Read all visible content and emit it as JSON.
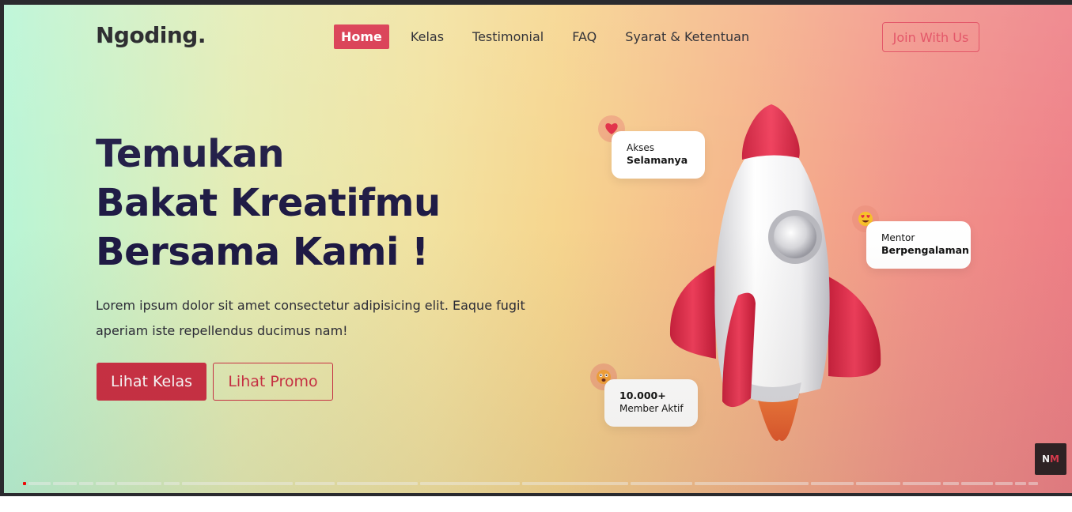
{
  "brand": {
    "logo_text": "Ngoding."
  },
  "nav": {
    "items": [
      {
        "label": "Home",
        "active": true
      },
      {
        "label": "Kelas",
        "active": false
      },
      {
        "label": "Testimonial",
        "active": false
      },
      {
        "label": "FAQ",
        "active": false
      },
      {
        "label": "Syarat & Ketentuan",
        "active": false
      }
    ],
    "cta_label": "Join With Us"
  },
  "hero": {
    "title_line1": "Temukan",
    "title_line2": "Bakat Kreatifmu",
    "title_line3": "Bersama Kami !",
    "description": "Lorem ipsum dolor sit amet consectetur adipisicing elit. Eaque fugit aperiam iste repellendus ducimus nam!",
    "primary_button": "Lihat Kelas",
    "secondary_button": "Lihat Promo"
  },
  "badges": [
    {
      "line1": "Akses",
      "line2": "Selamanya",
      "icon": "heart-icon"
    },
    {
      "line1": "Mentor",
      "line2": "Berpengalaman",
      "icon": "heart-eyes-emoji-icon"
    },
    {
      "line1": "10.000+",
      "line2": "Member Aktif",
      "icon": "dizzy-face-emoji-icon"
    }
  ],
  "watermark": {
    "text_a": "N",
    "text_b": "M"
  },
  "colors": {
    "accent": "#d8344b",
    "heading": "#1e1a44",
    "rocket_red": "#e0304c",
    "progress_played": "#ff0000"
  },
  "video_progress": {
    "played_fraction": 0.004
  }
}
